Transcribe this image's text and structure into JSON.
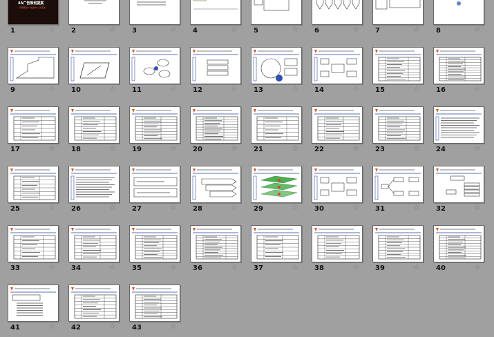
{
  "slide1": {
    "title": "4A广告策划提案",
    "subtitle": "——营销策划·广告运作·公关活动"
  },
  "slides": [
    {
      "number": "1",
      "layout": "cover"
    },
    {
      "number": "2",
      "layout": "text-center"
    },
    {
      "number": "3",
      "layout": "list"
    },
    {
      "number": "4",
      "layout": "flow"
    },
    {
      "number": "5",
      "layout": "house"
    },
    {
      "number": "6",
      "layout": "arrows"
    },
    {
      "number": "7",
      "layout": "boxes"
    },
    {
      "number": "8",
      "layout": "bubble"
    },
    {
      "number": "9",
      "layout": "step"
    },
    {
      "number": "10",
      "layout": "para"
    },
    {
      "number": "11",
      "layout": "cloud"
    },
    {
      "number": "12",
      "layout": "stack"
    },
    {
      "number": "13",
      "layout": "circle"
    },
    {
      "number": "14",
      "layout": "hub"
    },
    {
      "number": "15",
      "layout": "table"
    },
    {
      "number": "16",
      "layout": "table"
    },
    {
      "number": "17",
      "layout": "table"
    },
    {
      "number": "18",
      "layout": "table"
    },
    {
      "number": "19",
      "layout": "table"
    },
    {
      "number": "20",
      "layout": "table"
    },
    {
      "number": "21",
      "layout": "table"
    },
    {
      "number": "22",
      "layout": "table"
    },
    {
      "number": "23",
      "layout": "table"
    },
    {
      "number": "24",
      "layout": "text"
    },
    {
      "number": "25",
      "layout": "table"
    },
    {
      "number": "26",
      "layout": "text"
    },
    {
      "number": "27",
      "layout": "twobox"
    },
    {
      "number": "28",
      "layout": "chevron"
    },
    {
      "number": "29",
      "layout": "layers"
    },
    {
      "number": "30",
      "layout": "hub"
    },
    {
      "number": "31",
      "layout": "tree"
    },
    {
      "number": "32",
      "layout": "tree2"
    },
    {
      "number": "33",
      "layout": "table"
    },
    {
      "number": "34",
      "layout": "table"
    },
    {
      "number": "35",
      "layout": "table"
    },
    {
      "number": "36",
      "layout": "table"
    },
    {
      "number": "37",
      "layout": "table"
    },
    {
      "number": "38",
      "layout": "table"
    },
    {
      "number": "39",
      "layout": "table"
    },
    {
      "number": "40",
      "layout": "table"
    },
    {
      "number": "41",
      "layout": "textbox"
    },
    {
      "number": "42",
      "layout": "table"
    },
    {
      "number": "43",
      "layout": "table"
    }
  ],
  "star_glyph": "☆"
}
